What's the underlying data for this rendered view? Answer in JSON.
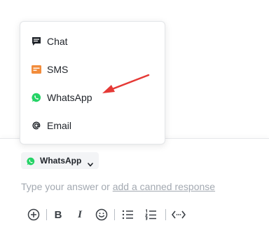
{
  "channel_menu": {
    "items": [
      {
        "label": "Chat",
        "icon": "chat-icon"
      },
      {
        "label": "SMS",
        "icon": "sms-icon"
      },
      {
        "label": "WhatsApp",
        "icon": "whatsapp-icon"
      },
      {
        "label": "Email",
        "icon": "at-icon"
      }
    ]
  },
  "composer": {
    "channel_selected": "WhatsApp",
    "placeholder_prefix": "Type your answer or ",
    "placeholder_link": "add a canned response"
  },
  "toolbar": {
    "buttons": [
      "add-icon",
      "bold-icon",
      "italic-icon",
      "emoji-icon",
      "bullet-list-icon",
      "numbered-list-icon",
      "code-icon"
    ],
    "bold_label": "B",
    "italic_label": "I"
  },
  "colors": {
    "whatsapp_green": "#25D366",
    "sms_orange": "#F28C3B",
    "annotation_arrow": "#E53935",
    "placeholder_gray": "#A3A9B1"
  }
}
